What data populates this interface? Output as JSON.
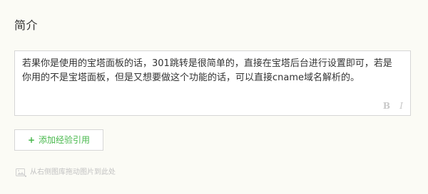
{
  "section": {
    "title": "简介"
  },
  "editor": {
    "content": "若果你是使用的宝塔面板的话，301跳转是很简单的，直接在宝塔后台进行设置即可，若是你用的不是宝塔面板，但是又想要做这个功能的话，可以直接cname域名解析的。",
    "bold_label": "B",
    "italic_label": "I"
  },
  "add_reference": {
    "plus": "+",
    "label": "添加经验引用"
  },
  "drag_hint": {
    "icon": "image-icon",
    "text": "从右侧图库拖动图片到此处"
  },
  "colors": {
    "background": "#fbfbf5",
    "accent_green": "#47b84b",
    "border": "#d6d6d6",
    "muted_text": "#c2c2c2"
  }
}
